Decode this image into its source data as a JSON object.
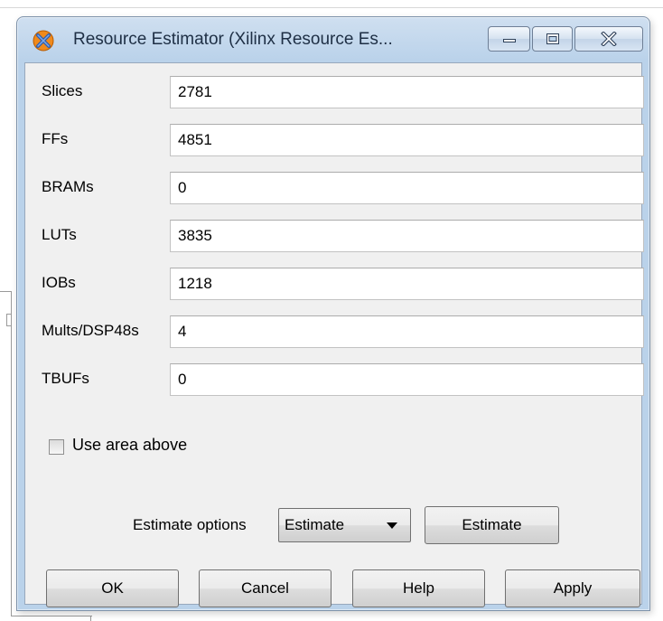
{
  "window": {
    "title": "Resource Estimator (Xilinx Resource Es...",
    "icon": "xilinx-app-icon"
  },
  "fields": [
    {
      "label": "Slices",
      "value": "2781"
    },
    {
      "label": "FFs",
      "value": "4851"
    },
    {
      "label": "BRAMs",
      "value": "0"
    },
    {
      "label": "LUTs",
      "value": "3835"
    },
    {
      "label": "IOBs",
      "value": "1218"
    },
    {
      "label": "Mults/DSP48s",
      "value": "4"
    },
    {
      "label": "TBUFs",
      "value": "0"
    }
  ],
  "use_area": {
    "label": "Use area above",
    "checked": false
  },
  "estimate_options": {
    "label": "Estimate options",
    "selected": "Estimate",
    "button_label": "Estimate"
  },
  "buttons": {
    "ok": "OK",
    "cancel": "Cancel",
    "help": "Help",
    "apply": "Apply"
  },
  "colors": {
    "title_bar": "#bad2ea",
    "client_bg": "#f0f0f0",
    "icon_orange": "#f08a1c",
    "icon_blue": "#2a5db0"
  }
}
